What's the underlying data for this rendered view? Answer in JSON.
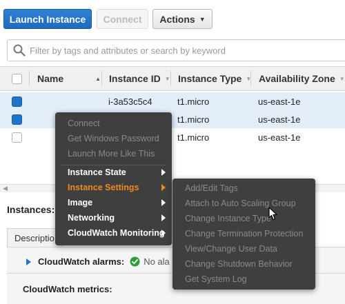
{
  "toolbar": {
    "launch_label": "Launch Instance",
    "connect_label": "Connect",
    "actions_label": "Actions"
  },
  "search": {
    "placeholder": "Filter by tags and attributes or search by keyword"
  },
  "table": {
    "columns": [
      "Name",
      "Instance ID",
      "Instance Type",
      "Availability Zone"
    ],
    "rows": [
      {
        "name": "",
        "instance_id": "i-3a53c5c4",
        "type": "t1.micro",
        "zone": "us-east-1e",
        "selected": true
      },
      {
        "name": "",
        "instance_id": "",
        "type": "t1.micro",
        "zone": "us-east-1e",
        "selected": true
      },
      {
        "name": "",
        "instance_id": "",
        "type": "t1.micro",
        "zone": "us-east-1e",
        "selected": false
      }
    ]
  },
  "bottom": {
    "instances_label": "Instances:",
    "description_tab": "Descriptio",
    "cloudwatch_alarms_label": "CloudWatch alarms:",
    "no_alarms_text": "No ala",
    "cloudwatch_metrics_label": "CloudWatch metrics:"
  },
  "context_menu": {
    "items": [
      {
        "label": "Connect",
        "state": "disabled"
      },
      {
        "label": "Get Windows Password",
        "state": "disabled"
      },
      {
        "label": "Launch More Like This",
        "state": "disabled"
      },
      {
        "label": "Instance State",
        "state": "submenu"
      },
      {
        "label": "Instance Settings",
        "state": "active-submenu"
      },
      {
        "label": "Image",
        "state": "submenu"
      },
      {
        "label": "Networking",
        "state": "submenu"
      },
      {
        "label": "CloudWatch Monitoring",
        "state": "submenu"
      }
    ]
  },
  "submenu": {
    "items": [
      "Add/Edit Tags",
      "Attach to Auto Scaling Group",
      "Change Instance Type",
      "Change Termination Protection",
      "View/Change User Data",
      "Change Shutdown Behavior",
      "Get System Log"
    ]
  },
  "colors": {
    "primary_button": "#1f6bbf",
    "menu_background": "#3f3f3f",
    "menu_active": "#f08a1c",
    "selected_row": "#e3edf8"
  }
}
